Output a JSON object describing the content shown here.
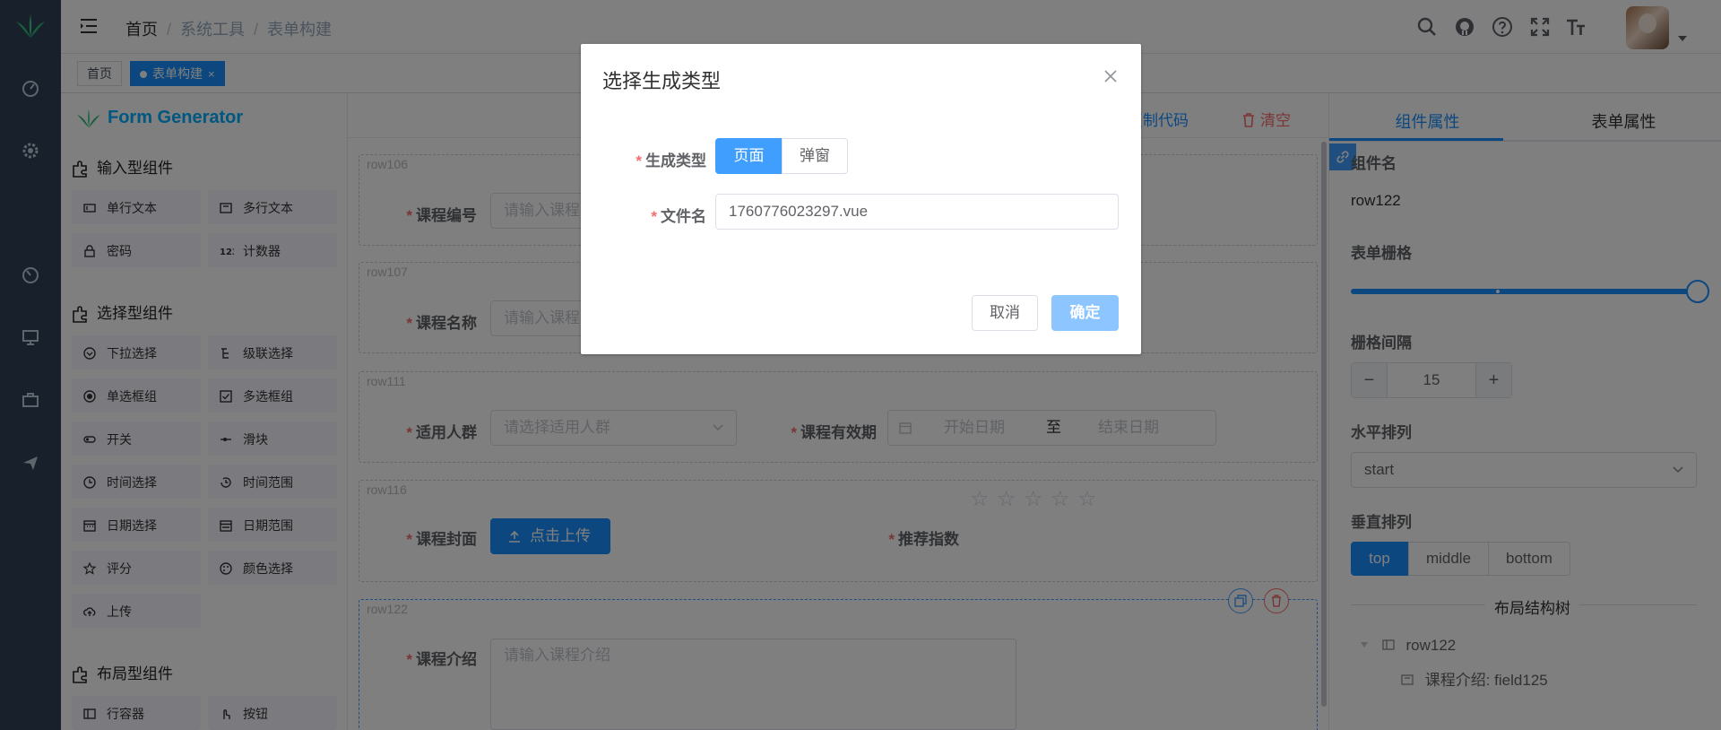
{
  "breadcrumb": [
    "首页",
    "系统工具",
    "表单构建"
  ],
  "tags": {
    "home": "首页",
    "active": "表单构建",
    "close": "×"
  },
  "logo_text": "Form Generator",
  "actions": {
    "copy_code": "复制代码",
    "clear": "清空"
  },
  "groups": {
    "input": {
      "title": "输入型组件",
      "items": [
        "单行文本",
        "多行文本",
        "密码",
        "计数器"
      ]
    },
    "select": {
      "title": "选择型组件",
      "items": [
        "下拉选择",
        "级联选择",
        "单选框组",
        "多选框组",
        "开关",
        "滑块",
        "时间选择",
        "时间范围",
        "日期选择",
        "日期范围",
        "评分",
        "颜色选择",
        "上传"
      ]
    },
    "layout": {
      "title": "布局型组件",
      "items": [
        "行容器",
        "按钮"
      ]
    }
  },
  "canvas": {
    "rows": [
      "row106",
      "row107",
      "row111",
      "row116",
      "row122"
    ],
    "course_no": {
      "label": "课程编号",
      "placeholder": "请输入课程"
    },
    "course_name": {
      "label": "课程名称",
      "placeholder": "请输入课程"
    },
    "audience": {
      "label": "适用人群",
      "placeholder": "请选择适用人群"
    },
    "validity": {
      "label": "课程有效期",
      "start": "开始日期",
      "to": "至",
      "end": "结束日期"
    },
    "cover": {
      "label": "课程封面",
      "button": "点击上传"
    },
    "rating": {
      "label": "推荐指数",
      "max": 5
    },
    "intro": {
      "label": "课程介绍",
      "placeholder": "请输入课程介绍"
    }
  },
  "props": {
    "tabs": [
      "组件属性",
      "表单属性"
    ],
    "comp_name_label": "组件名",
    "comp_name_value": "row122",
    "grid_label": "表单栅格",
    "grid_value": 24,
    "grid_max": 24,
    "gutter_label": "栅格间隔",
    "gutter_value": "15",
    "minus": "−",
    "plus": "+",
    "justify_label": "水平排列",
    "justify_value": "start",
    "align_label": "垂直排列",
    "align_options": [
      "top",
      "middle",
      "bottom"
    ],
    "align_selected": "top",
    "tree_title": "布局结构树",
    "tree_root": "row122",
    "tree_child": "课程介绍: field125"
  },
  "dialog": {
    "title": "选择生成类型",
    "type_label": "生成类型",
    "type_options": [
      "页面",
      "弹窗"
    ],
    "type_selected": "页面",
    "filename_label": "文件名",
    "filename_value": "1760776023297.vue",
    "cancel": "取消",
    "ok": "确定"
  },
  "colors": {
    "primary": "#1890ff",
    "danger": "#f56c6c",
    "sidebar": "#304156"
  }
}
